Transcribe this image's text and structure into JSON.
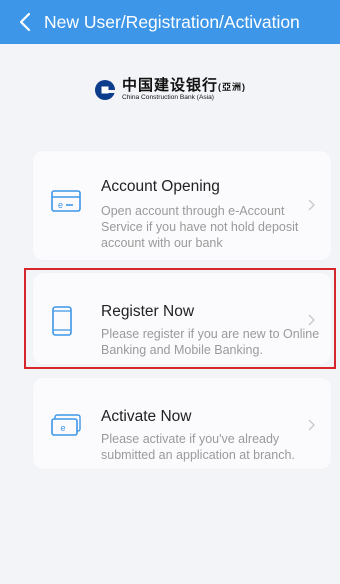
{
  "header": {
    "title": "New User/Registration/Activation",
    "background": "#3d96e8"
  },
  "logo": {
    "name_cn": "中国建设银行",
    "region_cn": "(亞洲)",
    "name_en": "China Construction Bank (Asia)"
  },
  "options": [
    {
      "title": "Account Opening",
      "desc": "Open account through e-Account Service if you have not hold deposit account with our bank",
      "icon": "card-e-icon"
    },
    {
      "title": "Register Now",
      "desc": "Please register if you are new to Online Banking and Mobile Banking.",
      "icon": "phone-icon",
      "highlighted": true
    },
    {
      "title": "Activate Now",
      "desc": "Please activate if you've already submitted an application at branch.",
      "icon": "activate-card-icon"
    }
  ],
  "highlight_color": "#d6262c"
}
